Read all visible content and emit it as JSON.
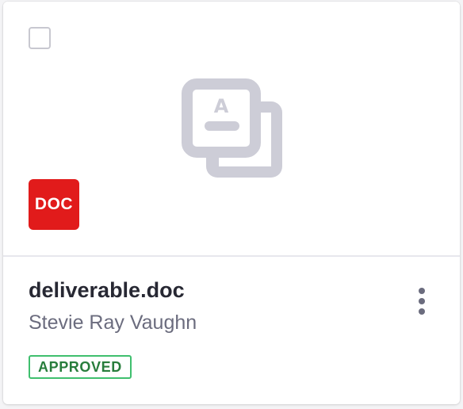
{
  "card": {
    "badge_label": "DOC",
    "filename": "deliverable.doc",
    "owner": "Stevie Ray Vaughn",
    "status": "APPROVED",
    "preview_icon": "document-copy-icon",
    "checkbox_checked": false
  },
  "colors": {
    "badge": "#e11b1b",
    "status_border": "#3fbf6e",
    "status_text": "#287d3c",
    "icon": "#cdcdd7"
  }
}
